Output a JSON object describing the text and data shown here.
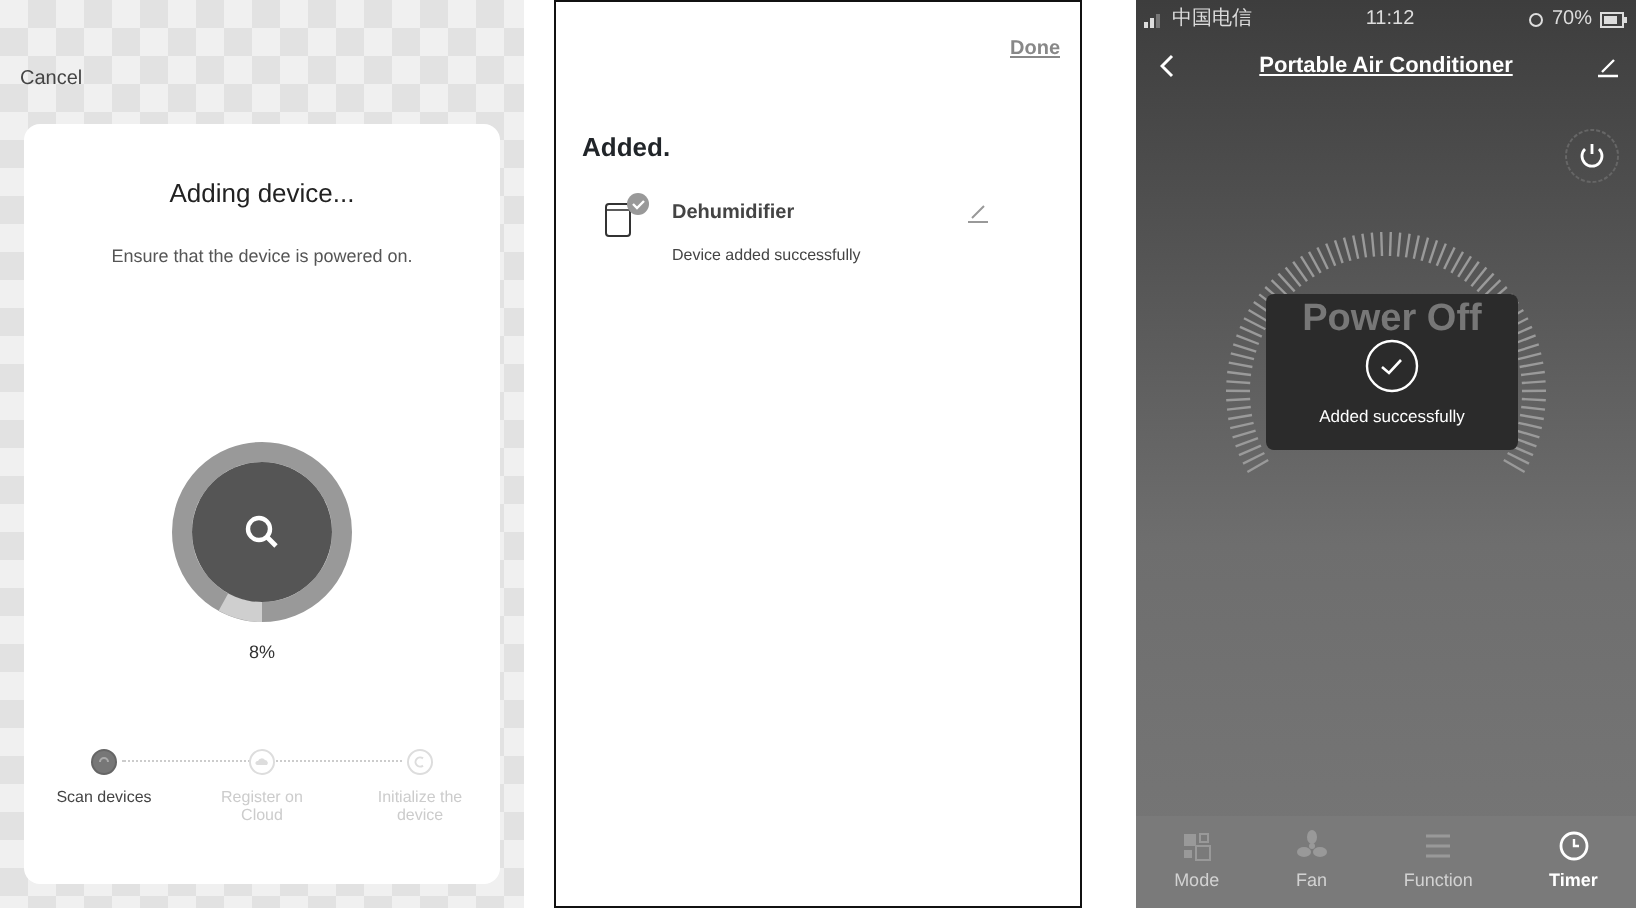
{
  "adding_screen": {
    "cancel": "Cancel",
    "title": "Adding device...",
    "subtitle": "Ensure that the device is powered on.",
    "progress": {
      "level": 0.08,
      "reading": "8%"
    },
    "steps": [
      {
        "label": "Scan devices",
        "kind": "scan",
        "active": true
      },
      {
        "label": "Register on Cloud",
        "kind": "cloud",
        "active": false
      },
      {
        "label": "Initialize the device",
        "kind": "init",
        "active": false
      }
    ]
  },
  "added_screen": {
    "done": "Done",
    "heading": "Added.",
    "device": {
      "name": "Dehumidifier",
      "status": "Device added successfully"
    }
  },
  "device_screen": {
    "status_bar": {
      "carrier": "中国电信",
      "time": "11:12",
      "battery": "70%"
    },
    "title": "Portable Air Conditioner",
    "state": "Power Off",
    "toast": "Added successfully",
    "tabs": [
      {
        "label": "Mode",
        "kind": "mode",
        "selected": false
      },
      {
        "label": "Fan",
        "kind": "fan",
        "selected": false
      },
      {
        "label": "Function",
        "kind": "function",
        "selected": false
      },
      {
        "label": "Timer",
        "kind": "timer",
        "selected": true
      }
    ]
  }
}
